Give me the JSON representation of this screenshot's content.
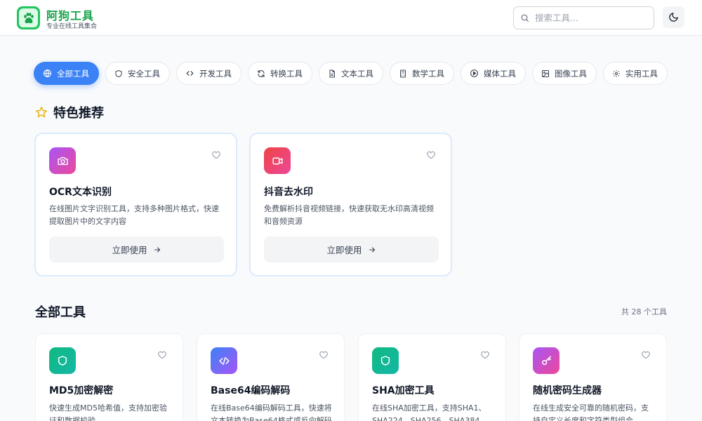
{
  "header": {
    "brand_title": "阿狗工具",
    "brand_subtitle": "专业在线工具集合",
    "search_placeholder": "搜索工具...",
    "logo_icon": "paw-icon",
    "theme_icon": "moon-icon"
  },
  "categories": [
    {
      "label": "全部工具",
      "icon": "globe-icon",
      "active": true
    },
    {
      "label": "安全工具",
      "icon": "shield-icon",
      "active": false
    },
    {
      "label": "开发工具",
      "icon": "code-icon",
      "active": false
    },
    {
      "label": "转换工具",
      "icon": "refresh-icon",
      "active": false
    },
    {
      "label": "文本工具",
      "icon": "file-text-icon",
      "active": false
    },
    {
      "label": "数学工具",
      "icon": "calculator-icon",
      "active": false
    },
    {
      "label": "媒体工具",
      "icon": "play-circle-icon",
      "active": false
    },
    {
      "label": "图像工具",
      "icon": "image-icon",
      "active": false
    },
    {
      "label": "实用工具",
      "icon": "settings-icon",
      "active": false
    }
  ],
  "featured": {
    "title": "特色推荐",
    "icon": "star-icon",
    "cards": [
      {
        "title": "OCR文本识别",
        "description": "在线图片文字识别工具，支持多种图片格式，快速提取图片中的文字内容",
        "button": "立即使用",
        "icon": "camera-icon",
        "gradient": [
          "#a855f7",
          "#ec4899"
        ]
      },
      {
        "title": "抖音去水印",
        "description": "免费解析抖音视频链接，快速获取无水印高清视频和音频资源",
        "button": "立即使用",
        "icon": "video-icon",
        "gradient": [
          "#ef4444",
          "#ec4899"
        ]
      }
    ]
  },
  "all_tools": {
    "title": "全部工具",
    "count_text": "共 28 个工具",
    "cards": [
      {
        "title": "MD5加密解密",
        "description": "快速生成MD5哈希值，支持加密验证和数据校验",
        "icon": "shield-icon",
        "gradient": [
          "#10b981",
          "#14b8a6"
        ]
      },
      {
        "title": "Base64编码解码",
        "description": "在线Base64编码解码工具，快速将文本转换为Base64格式或反向解码",
        "icon": "code-icon",
        "gradient": [
          "#3b82f6",
          "#a855f7"
        ]
      },
      {
        "title": "SHA加密工具",
        "description": "在线SHA加密工具，支持SHA1、SHA224、SHA256、SHA384",
        "icon": "shield-icon",
        "gradient": [
          "#10b981",
          "#14b8a6"
        ]
      },
      {
        "title": "随机密码生成器",
        "description": "在线生成安全可靠的随机密码，支持自定义长度和字符类型组合",
        "icon": "key-icon",
        "gradient": [
          "#a855f7",
          "#ec4899"
        ]
      }
    ]
  }
}
